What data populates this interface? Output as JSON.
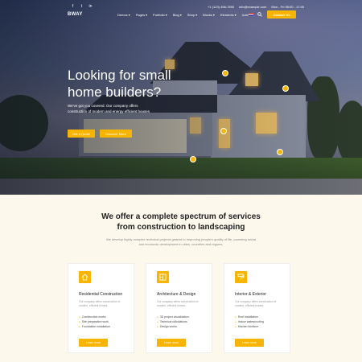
{
  "topbar": {
    "social": [
      "f",
      "t",
      "in"
    ],
    "phone": "+1 (123) 456-7890",
    "email": "info@example.com",
    "hours": "Mon - Fri 08:00 - 17:00"
  },
  "nav": {
    "logo": "BWAY",
    "menu": [
      "Demos",
      "Pages",
      "Portfolio",
      "Blog",
      "Shop",
      "Blocks",
      "Elements",
      "Icons"
    ],
    "cta": "Contact Us"
  },
  "hero": {
    "title_line1": "Looking for small",
    "title_line2": "home builders?",
    "subtitle": "We've got you covered. Our company offers construction of modern and energy efficient houses",
    "primary_button": "Get a Quote",
    "secondary_button": "Discover More"
  },
  "services": {
    "title_line1": "We offer a complete spectrum of services",
    "title_line2": "from construction to landscaping",
    "description": "We develop highly complex technical projects geared to improving people's quality of life, powering social and economic development in cities, countries and regions.",
    "cards": [
      {
        "title": "Residential Construction",
        "text": "Our company offers construction of modern, efficient homes.",
        "items": [
          "Construction works",
          "Site preparation work",
          "Foundation installation"
        ],
        "button": "Learn more",
        "icon": "house-icon"
      },
      {
        "title": "Architecture & Design",
        "text": "Our company offers construction of modern, efficient homes.",
        "items": [
          "3D project visualization",
          "Technical calculations",
          "Design works"
        ],
        "button": "Learn more",
        "icon": "blueprint-icon"
      },
      {
        "title": "Interior & Exterior",
        "text": "Our company offers construction of modern, efficient homes.",
        "items": [
          "Roof installation",
          "Indoor waterproofing",
          "Kitchen furniture"
        ],
        "button": "Learn more",
        "icon": "paint-roller-icon"
      }
    ]
  },
  "colors": {
    "accent": "#f7b500",
    "background": "#fdf8ec"
  }
}
